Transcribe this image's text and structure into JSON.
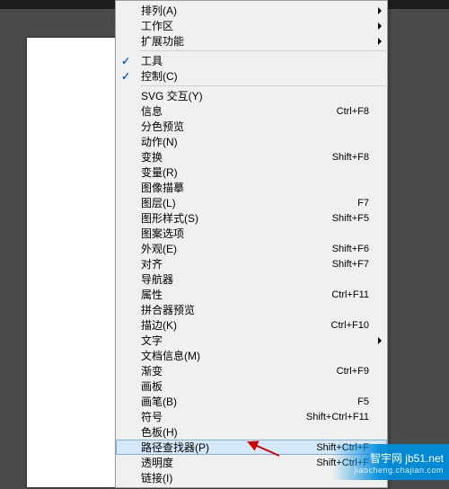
{
  "menu": {
    "group1": [
      {
        "label": "排列(A)",
        "submenu": true
      },
      {
        "label": "工作区",
        "submenu": true
      },
      {
        "label": "扩展功能",
        "submenu": true
      }
    ],
    "group2": [
      {
        "label": "工具",
        "checked": true
      },
      {
        "label": "控制(C)",
        "checked": true
      }
    ],
    "group3": [
      {
        "label": "SVG 交互(Y)"
      },
      {
        "label": "信息",
        "shortcut": "Ctrl+F8"
      },
      {
        "label": "分色预览"
      },
      {
        "label": "动作(N)"
      },
      {
        "label": "变换",
        "shortcut": "Shift+F8"
      },
      {
        "label": "变量(R)"
      },
      {
        "label": "图像描摹"
      },
      {
        "label": "图层(L)",
        "shortcut": "F7"
      },
      {
        "label": "图形样式(S)",
        "shortcut": "Shift+F5"
      },
      {
        "label": "图案选项"
      },
      {
        "label": "外观(E)",
        "shortcut": "Shift+F6"
      },
      {
        "label": "对齐",
        "shortcut": "Shift+F7"
      },
      {
        "label": "导航器"
      },
      {
        "label": "属性",
        "shortcut": "Ctrl+F11"
      },
      {
        "label": "拼合器预览"
      },
      {
        "label": "描边(K)",
        "shortcut": "Ctrl+F10"
      },
      {
        "label": "文字",
        "submenu": true
      },
      {
        "label": "文档信息(M)"
      },
      {
        "label": "渐变",
        "shortcut": "Ctrl+F9"
      },
      {
        "label": "画板"
      },
      {
        "label": "画笔(B)",
        "shortcut": "F5"
      },
      {
        "label": "符号",
        "shortcut": "Shift+Ctrl+F11"
      },
      {
        "label": "色板(H)"
      },
      {
        "label": "路径查找器(P)",
        "shortcut": "Shift+Ctrl+F",
        "highlight": true
      },
      {
        "label": "透明度",
        "shortcut": "Shift+Ctrl+F"
      },
      {
        "label": "链接(I)"
      }
    ]
  },
  "watermark": {
    "line1": "智宇网 jb51.net",
    "line2": "jiaocheng.chajian.com"
  }
}
